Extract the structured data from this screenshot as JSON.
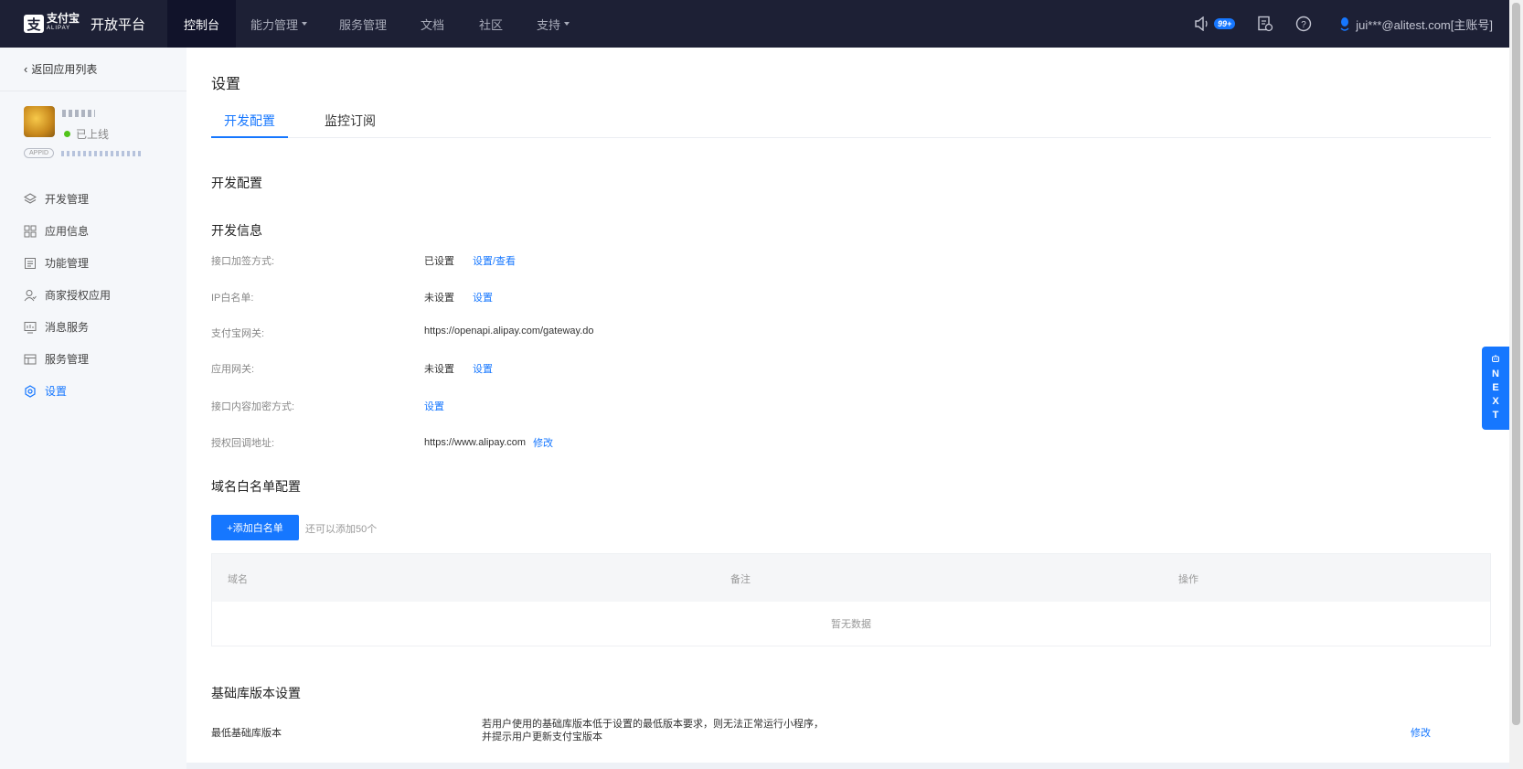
{
  "nav": {
    "logo_mark": "支",
    "logo_brand": "支付宝",
    "logo_brand_en": "ALIPAY",
    "logo_title": "开放平台",
    "items": [
      {
        "label": "控制台",
        "active": true,
        "dropdown": false
      },
      {
        "label": "能力管理",
        "active": false,
        "dropdown": true
      },
      {
        "label": "服务管理",
        "active": false,
        "dropdown": false
      },
      {
        "label": "文档",
        "active": false,
        "dropdown": false
      },
      {
        "label": "社区",
        "active": false,
        "dropdown": false
      },
      {
        "label": "支持",
        "active": false,
        "dropdown": true
      }
    ],
    "notification_badge": "99+",
    "user": "jui***@alitest.com[主账号]",
    "icons": [
      "speaker-icon",
      "doc-clock-icon",
      "help-icon",
      "user-icon"
    ]
  },
  "sidebar": {
    "back_label": "返回应用列表",
    "app_status": "已上线",
    "appid_tag": "APPID",
    "menu": [
      {
        "label": "开发管理",
        "icon": "layers-icon",
        "active": false
      },
      {
        "label": "应用信息",
        "icon": "grid-icon",
        "active": false
      },
      {
        "label": "功能管理",
        "icon": "list-icon",
        "active": false
      },
      {
        "label": "商家授权应用",
        "icon": "user-auth-icon",
        "active": false
      },
      {
        "label": "消息服务",
        "icon": "monitor-icon",
        "active": false
      },
      {
        "label": "服务管理",
        "icon": "table-icon",
        "active": false
      },
      {
        "label": "设置",
        "icon": "gear-icon",
        "active": true
      }
    ]
  },
  "main": {
    "title": "设置",
    "tabs": [
      {
        "label": "开发配置",
        "active": true
      },
      {
        "label": "监控订阅",
        "active": false
      }
    ],
    "section_dev_config": "开发配置",
    "section_dev_info": "开发信息",
    "dev_info": [
      {
        "label": "接口加签方式:",
        "value": "已设置",
        "action": "设置/查看"
      },
      {
        "label": "IP白名单:",
        "value": "未设置",
        "action": "设置"
      },
      {
        "label": "支付宝网关:",
        "value": "https://openapi.alipay.com/gateway.do",
        "action": ""
      },
      {
        "label": "应用网关:",
        "value": "未设置",
        "action": "设置"
      },
      {
        "label": "接口内容加密方式:",
        "value": "",
        "action": "设置"
      },
      {
        "label": "授权回调地址:",
        "value": "https://www.alipay.com",
        "action": "修改"
      }
    ],
    "section_domain": "域名白名单配置",
    "add_button": "+添加白名单",
    "add_hint": "还可以添加50个",
    "table": {
      "columns": [
        "域名",
        "备注",
        "操作"
      ],
      "empty_text": "暂无数据"
    },
    "section_lib": "基础库版本设置",
    "lib_label": "最低基础库版本",
    "lib_desc_1": "若用户使用的基础库版本低于设置的最低版本要求，则无法正常运行小程序，",
    "lib_desc_2": "并提示用户更新支付宝版本",
    "lib_action": "修改"
  },
  "float_next": {
    "letters": [
      "N",
      "E",
      "X",
      "T"
    ]
  },
  "colors": {
    "nav_bg": "#1d2035",
    "accent": "#1677ff",
    "sidebar_bg": "#f5f7fa",
    "online": "#52c41a"
  }
}
